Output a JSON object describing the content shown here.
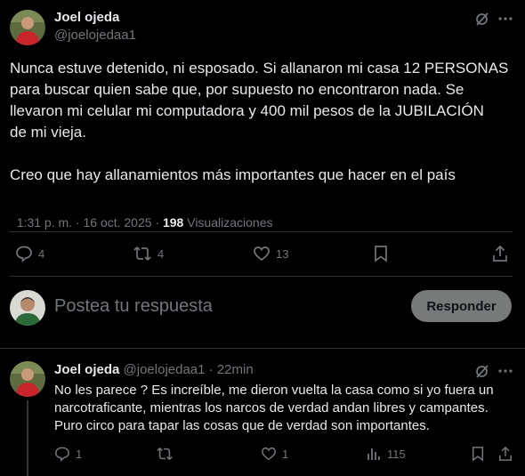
{
  "main_tweet": {
    "author_name": "Joel ojeda",
    "author_handle": "@joelojedaa1",
    "text_lines": [
      "Nunca estuve detenido, ni esposado. Si allanaron mi casa 12 PERSONAS",
      "para buscar quien sabe que, por supuesto no encontraron nada. Se",
      "llevaron mi celular mi computadora y 400 mil pesos de la JUBILACIÓN",
      "de mi vieja."
    ],
    "text_line_2": "Creo que hay allanamientos más importantes que hacer en el país",
    "timestamp": "1:31 p. m. · 16 oct. 2025 · ",
    "views_count": "198",
    "views_label": " Visualizaciones",
    "actions": {
      "replies": "4",
      "reposts": "4",
      "likes": "13"
    }
  },
  "compose": {
    "placeholder": "Postea tu respuesta",
    "button_label": "Responder"
  },
  "reply": {
    "author_name": "Joel ojeda",
    "author_handle": "@joelojedaa1",
    "dot": "·",
    "time": "22min",
    "text_lines": [
      "No les parece ? Es increíble, me dieron vuelta la casa como si yo fuera un",
      "narcotraficante, mientras los narcos de verdad andan libres y campantes.",
      "Puro circo para tapar las cosas que de verdad son importantes."
    ],
    "actions": {
      "replies": "1",
      "likes": "1",
      "views": "115"
    }
  },
  "colors": {
    "background": "#000000",
    "text": "#e7e9ea",
    "muted": "#71767b",
    "separator": "#2f3336"
  }
}
